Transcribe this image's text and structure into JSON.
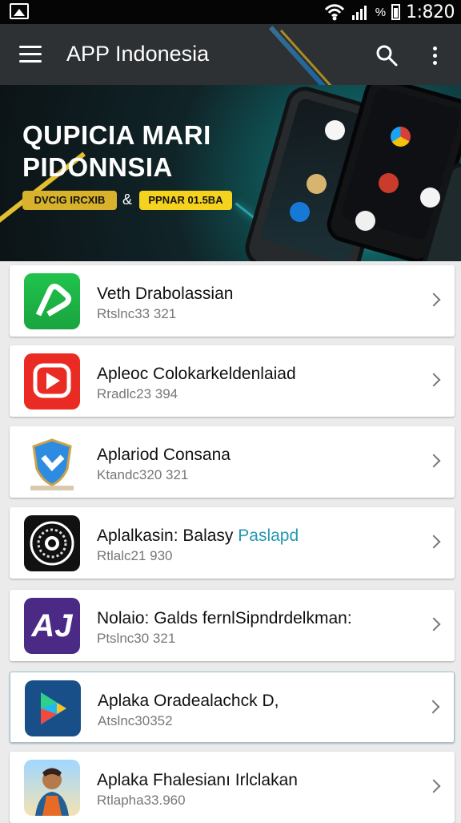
{
  "status": {
    "time": "1:820",
    "battery_percent": "%",
    "signal_bars": 4
  },
  "header": {
    "title": "APP Indonesia"
  },
  "banner": {
    "line1": "QUPICIA MARI",
    "line2": "PIDONNSIA",
    "left_badge": "DVCIG IRCXIB",
    "separator": "&",
    "right_badge": "PPNAR 01.5BA"
  },
  "apps": [
    {
      "name": "Veth Drabolassian",
      "name_accent": "",
      "meta": "Rtslnc33 321",
      "icon": "green-play-icon",
      "highlight": false
    },
    {
      "name": "Apleoc Colokarkeldenlaiad",
      "name_accent": "",
      "meta": "Rradlc23 394",
      "icon": "red-play-icon",
      "highlight": false
    },
    {
      "name": "Aplariod Consana",
      "name_accent": "",
      "meta": "Ktandc320 321",
      "icon": "shield-icon",
      "highlight": false
    },
    {
      "name": "Aplalkasin: Balasy ",
      "name_accent": "Paslapd",
      "meta": "Rtlalc21 930",
      "icon": "circle-dial-icon",
      "highlight": false
    },
    {
      "name": "Nolaio: Galds fernlSipndrdelkman:",
      "name_accent": "",
      "meta": "Ptslnc30 321",
      "icon": "aj-icon",
      "highlight": false
    },
    {
      "name": "Aplaka Oradealachck D,",
      "name_accent": "",
      "meta": "Atslnc30352",
      "icon": "play-store-icon",
      "highlight": true
    },
    {
      "name": "Aplaka Fhalesianı Irlclakan",
      "name_accent": "",
      "meta": "Rtlapha33.960",
      "icon": "person-icon",
      "highlight": false
    }
  ],
  "colors": {
    "app_bar": "#2d3134",
    "accent": "#2598b2",
    "gold": "#f5d21e"
  }
}
